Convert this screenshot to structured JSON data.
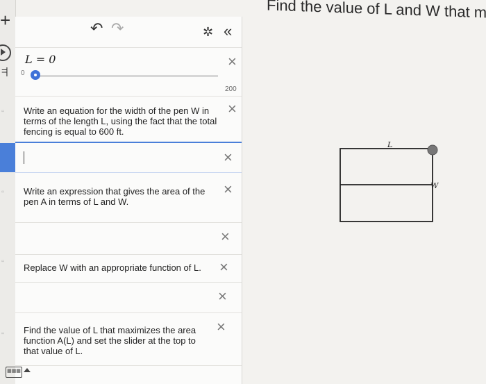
{
  "page": {
    "heading": "Find the value of L and W that maxir"
  },
  "toolbar": {
    "add_icon": "plus-icon",
    "play_icon": "play-icon",
    "equals_icon": "equals-icon",
    "quote_icon": "quote-icon"
  },
  "panel": {
    "undo_icon": "undo-icon",
    "redo_icon": "redo-icon",
    "settings_icon": "gear-icon",
    "collapse_icon": "chevron-double-left-icon",
    "slider": {
      "expression": "L = 0",
      "min": "0",
      "max": "200",
      "value": 0
    },
    "items": [
      {
        "text": "Write an equation for the width of the pen W in terms of the length L, using the fact that the total fencing is equal to 600 ft."
      },
      {
        "text": ""
      },
      {
        "text": "Write an expression that gives the area of the pen A in terms of L and W."
      },
      {
        "text": ""
      },
      {
        "text": "Replace W with an appropriate function of L."
      },
      {
        "text": ""
      },
      {
        "text": "Find the value of L that maximizes the area function A(L) and set the slider at the top to that value of L."
      }
    ],
    "close_label": "×"
  },
  "graph": {
    "label_length": "L",
    "label_width": "W"
  }
}
